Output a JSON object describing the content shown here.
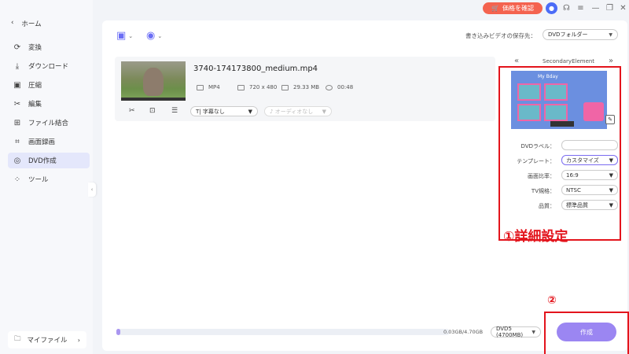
{
  "titlebar": {
    "price_label": "価格を確認",
    "window_controls": [
      "≡",
      "—",
      "❐",
      "✕"
    ]
  },
  "sidebar": {
    "home_label": "ホーム",
    "items": [
      {
        "label": "変換",
        "icon": "convert-icon",
        "glyph": "⟳"
      },
      {
        "label": "ダウンロード",
        "icon": "download-icon",
        "glyph": "⤓"
      },
      {
        "label": "圧縮",
        "icon": "compress-icon",
        "glyph": "▣"
      },
      {
        "label": "編集",
        "icon": "scissors-icon",
        "glyph": "✂"
      },
      {
        "label": "ファイル結合",
        "icon": "merge-icon",
        "glyph": "⊞"
      },
      {
        "label": "画面録画",
        "icon": "screen-record-icon",
        "glyph": "⌗"
      },
      {
        "label": "DVD作成",
        "icon": "dvd-icon",
        "glyph": "◎"
      },
      {
        "label": "ツール",
        "icon": "tools-icon",
        "glyph": "⁘"
      }
    ],
    "my_files_label": "マイファイル"
  },
  "main": {
    "save_label": "書き込みビデオの保存先：",
    "save_target": "DVDフォルダー",
    "file": {
      "name": "3740-174173800_medium.mp4",
      "format": "MP4",
      "resolution": "720 x 480",
      "size": "29.33 MB",
      "duration": "00:48",
      "subtitle": "字幕なし",
      "audio": "オーディオなし"
    }
  },
  "settings": {
    "preview_title": "SecondaryElement",
    "template_caption": "My Bday",
    "dvd_label_label": "DVDラベル：",
    "dvd_label_value": "",
    "template_label": "テンプレート：",
    "template_value": "カスタマイズ",
    "aspect_label": "画面比率：",
    "aspect_value": "16:9",
    "tv_label": "TV規格：",
    "tv_value": "NTSC",
    "quality_label": "品質：",
    "quality_value": "標準品質"
  },
  "bottom": {
    "progress_fraction": 0.007,
    "size_text": "0.03GB/4.70GB",
    "disc_type": "DVD5 (4700MB)",
    "create_label": "作成"
  },
  "annotations": {
    "detail_settings": "①詳細設定",
    "step2": "②"
  },
  "colors": {
    "accent": "#9b86f2",
    "annotation_red": "#e3141c",
    "price_badge": "#f4634f"
  }
}
